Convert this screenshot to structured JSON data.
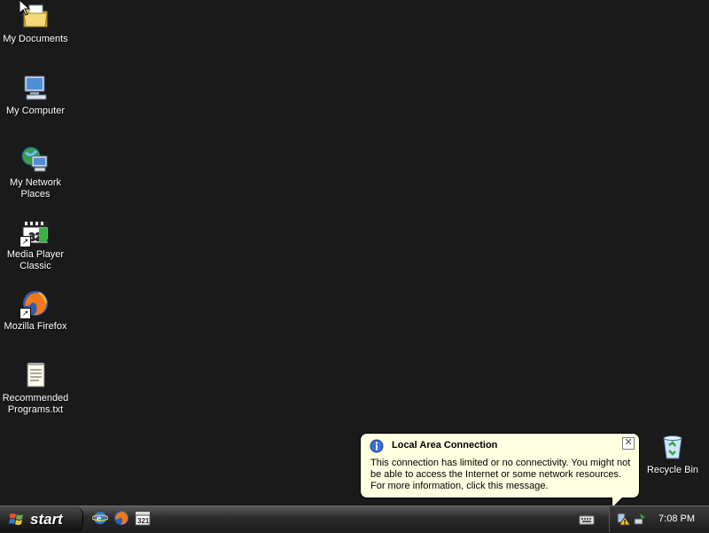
{
  "desktop": {
    "icons": [
      {
        "label": "My Documents"
      },
      {
        "label": "My Computer"
      },
      {
        "label": "My Network Places"
      },
      {
        "label": "Media Player Classic"
      },
      {
        "label": "Mozilla Firefox"
      },
      {
        "label": "Recommended Programs.txt"
      },
      {
        "label": "Recycle Bin"
      }
    ]
  },
  "taskbar": {
    "start_label": "start",
    "quicklaunch": [
      "internet-explorer-icon",
      "firefox-icon",
      "media-player-classic-icon"
    ],
    "clock": "7:08 PM"
  },
  "balloon": {
    "title": "Local Area Connection",
    "message": "This connection has limited or no connectivity. You might not be able to access the Internet or some network resources. For more information, click this message.",
    "close_glyph": "✕"
  },
  "colors": {
    "desktop_bg": "#1a1a1a",
    "balloon_bg": "#ffffe1",
    "taskbar": "#2c2c2c"
  }
}
